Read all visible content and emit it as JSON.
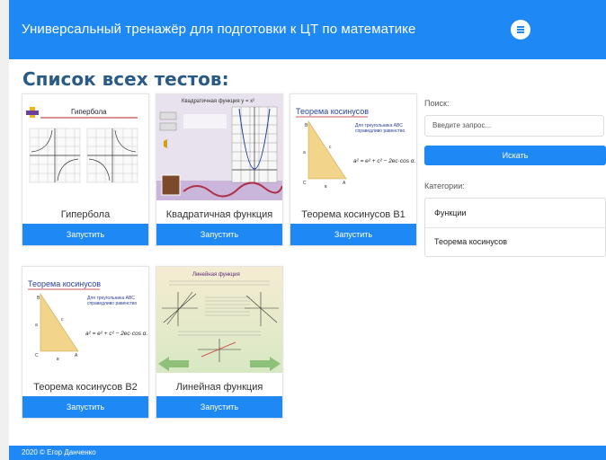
{
  "header": {
    "title": "Универсальный тренажёр для подготовки к ЦТ по математике",
    "menu_icon": "hamburger-menu-icon"
  },
  "main": {
    "page_title": "Список всех тестов:",
    "run_label": "Запустить",
    "tests": [
      {
        "name": "Гипербола",
        "thumb_title": "Гипербола"
      },
      {
        "name": "Квадратичная функция",
        "thumb_title": "Квадратичная функция y = x²"
      },
      {
        "name": "Теорема косинусов В1",
        "thumb_title": "Теорема косинусов"
      },
      {
        "name": "Теорема косинусов В2",
        "thumb_title": "Теорема косинусов"
      },
      {
        "name": "Линейная функция",
        "thumb_title": "Линейная функция"
      }
    ],
    "thumb_texts": {
      "triangle_caption": "Для треугольника ABC справедливо равенство",
      "formula": "a² = e² + c² − 2ec·cos α.",
      "vertex_a": "A",
      "vertex_b": "B",
      "vertex_c": "C",
      "side_a": "a",
      "side_b": "в",
      "side_c": "c"
    }
  },
  "sidebar": {
    "search_label": "Поиск:",
    "search_placeholder": "Введите запрос...",
    "search_button": "Искать",
    "categories_label": "Категории:",
    "categories": [
      "Функции",
      "Теорема косинусов"
    ]
  },
  "footer": {
    "text": "2020 © Егор Данченко"
  },
  "colors": {
    "accent": "#1e88f5",
    "page_title": "#2a5b86"
  }
}
